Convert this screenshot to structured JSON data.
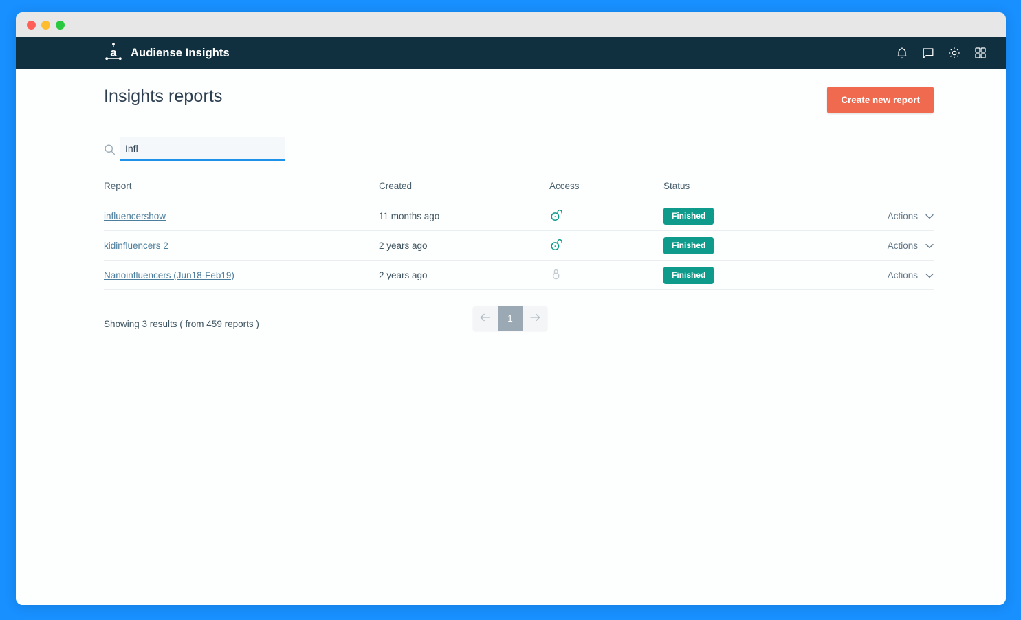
{
  "window": {
    "traffic_lights": [
      "close",
      "minimize",
      "maximize"
    ]
  },
  "appbar": {
    "logo_icon": "audiense-a-logo-icon",
    "brand": "Audiense Insights",
    "icons": [
      {
        "name": "bell-icon",
        "label": "Notifications"
      },
      {
        "name": "chat-bubble-icon",
        "label": "Messages"
      },
      {
        "name": "gear-icon",
        "label": "Settings"
      },
      {
        "name": "grid-apps-icon",
        "label": "Apps"
      }
    ]
  },
  "header": {
    "title": "Insights reports",
    "create_button": "Create new report"
  },
  "search": {
    "icon": "search-icon",
    "value": "Infl",
    "placeholder": "Search"
  },
  "table": {
    "columns": [
      "Report",
      "Created",
      "Access",
      "Status"
    ],
    "actions_label": "Actions",
    "rows": [
      {
        "report": "influencershow",
        "created": "11 months ago",
        "access": "unlocked",
        "access_icon": "unlock-icon",
        "status": "Finished",
        "actions": "Actions"
      },
      {
        "report": "kidinfluencers 2",
        "created": "2 years ago",
        "access": "unlocked",
        "access_icon": "unlock-icon",
        "status": "Finished",
        "actions": "Actions"
      },
      {
        "report": "Nanoinfluencers (Jun18-Feb19)",
        "created": "2 years ago",
        "access": "locked",
        "access_icon": "lock-icon",
        "status": "Finished",
        "actions": "Actions"
      }
    ]
  },
  "footer": {
    "results_text": "Showing 3 results ( from 459 reports )",
    "pagination": {
      "prev_icon": "arrow-left-icon",
      "next_icon": "arrow-right-icon",
      "current_page": "1"
    }
  },
  "colors": {
    "desktop_blue": "#1890ff",
    "appbar_dark": "#10303f",
    "accent_coral": "#ef6a4e",
    "badge_teal": "#0e9b8b",
    "unlock_teal": "#0e9b8b",
    "lock_gray": "#c4ccd1",
    "link_blue": "#4c7d9c",
    "search_underline": "#1d92e8"
  }
}
